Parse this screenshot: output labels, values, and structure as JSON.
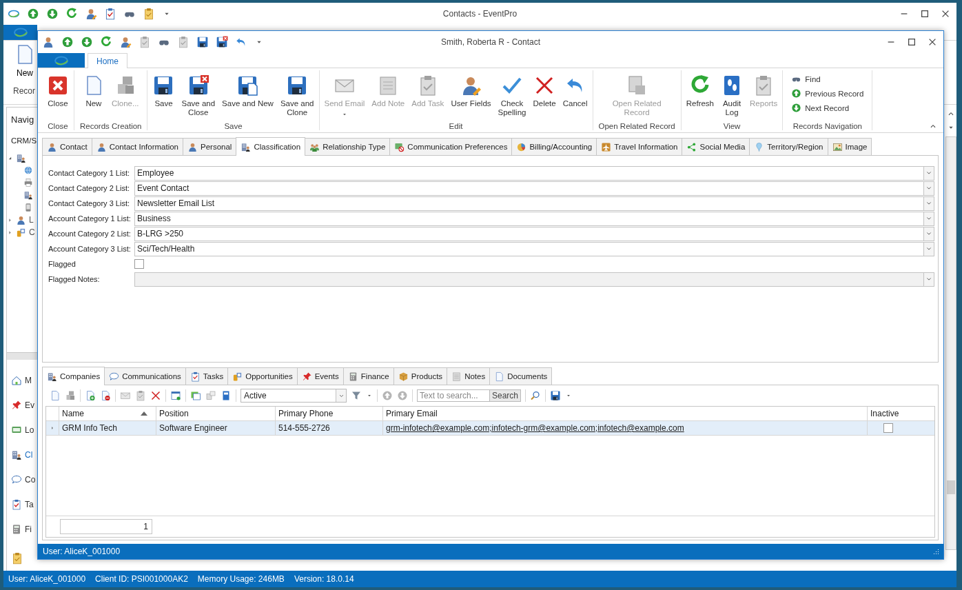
{
  "background_window": {
    "title": "Contacts - EventPro",
    "ribbon": {
      "button": "New",
      "group_label": "Recor"
    },
    "navigation": {
      "header": "Navig",
      "subheader": "CRM/S",
      "tree": [
        {
          "expanded": true,
          "children": [
            {
              "kind": "globe"
            },
            {
              "kind": "printer"
            },
            {
              "kind": "building"
            },
            {
              "kind": "phone"
            }
          ]
        },
        {
          "label": "L",
          "expanded": false
        },
        {
          "label": "C",
          "expanded": false
        }
      ],
      "items": [
        {
          "label": "M",
          "selected": false
        },
        {
          "label": "Ev",
          "selected": false
        },
        {
          "label": "Lo",
          "selected": false
        },
        {
          "label": "Cl",
          "selected": true
        },
        {
          "label": "Co",
          "selected": false
        },
        {
          "label": "Ta",
          "selected": false
        },
        {
          "label": "Fi",
          "selected": false
        }
      ]
    },
    "status_bar": [
      "User: AliceK_001000",
      "Client ID: PSI001000AK2",
      "Memory Usage: 246MB",
      "Version: 18.0.14"
    ]
  },
  "window": {
    "title": "Smith, Roberta R - Contact"
  },
  "ribbon": {
    "tabs": [
      {
        "label": "Home",
        "selected": true
      }
    ],
    "groups": [
      {
        "label": "Close",
        "buttons": [
          {
            "label": "Close",
            "disabled": false
          }
        ]
      },
      {
        "label": "Records Creation",
        "buttons": [
          {
            "label": "New",
            "disabled": false
          },
          {
            "label": "Clone...",
            "disabled": true
          }
        ]
      },
      {
        "label": "Save",
        "buttons": [
          {
            "label": "Save",
            "disabled": false
          },
          {
            "label": "Save and\nClose",
            "disabled": false
          },
          {
            "label": "Save and New",
            "disabled": false
          },
          {
            "label": "Save and\nClone",
            "disabled": false
          }
        ]
      },
      {
        "label": "Edit",
        "buttons": [
          {
            "label": "Send Email",
            "disabled": true,
            "dropdown": true
          },
          {
            "label": "Add Note",
            "disabled": true
          },
          {
            "label": "Add Task",
            "disabled": true
          },
          {
            "label": "User Fields",
            "disabled": false
          },
          {
            "label": "Check\nSpelling",
            "disabled": false
          },
          {
            "label": "Delete",
            "disabled": false
          },
          {
            "label": "Cancel",
            "disabled": false
          }
        ]
      },
      {
        "label": "Open Related Record",
        "buttons": [
          {
            "label": "Open Related\nRecord",
            "disabled": true
          }
        ]
      },
      {
        "label": "View",
        "buttons": [
          {
            "label": "Refresh",
            "disabled": false
          },
          {
            "label": "Audit\nLog",
            "disabled": false
          },
          {
            "label": "Reports",
            "disabled": true
          }
        ]
      }
    ],
    "navigation_group": {
      "label": "Records Navigation",
      "items": [
        "Find",
        "Previous Record",
        "Next Record"
      ]
    }
  },
  "tabs": [
    {
      "label": "Contact",
      "selected": false
    },
    {
      "label": "Contact Information",
      "selected": false
    },
    {
      "label": "Personal",
      "selected": false
    },
    {
      "label": "Classification",
      "selected": true
    },
    {
      "label": "Relationship Type",
      "selected": false
    },
    {
      "label": "Communication Preferences",
      "selected": false
    },
    {
      "label": "Billing/Accounting",
      "selected": false
    },
    {
      "label": "Travel Information",
      "selected": false
    },
    {
      "label": "Social Media",
      "selected": false
    },
    {
      "label": "Territory/Region",
      "selected": false
    },
    {
      "label": "Image",
      "selected": false
    }
  ],
  "fields": [
    {
      "kind": "combo",
      "label": "Contact Category 1 List:",
      "value": "Employee",
      "disabled": false
    },
    {
      "kind": "combo",
      "label": "Contact Category 2 List:",
      "value": "Event Contact",
      "disabled": false
    },
    {
      "kind": "combo",
      "label": "Contact Category 3 List:",
      "value": "Newsletter Email List",
      "disabled": false
    },
    {
      "kind": "combo",
      "label": "Account Category 1 List:",
      "value": "Business",
      "disabled": false
    },
    {
      "kind": "combo",
      "label": "Account Category 2 List:",
      "value": "B-LRG >250",
      "disabled": false
    },
    {
      "kind": "combo",
      "label": "Account Category 3 List:",
      "value": "Sci/Tech/Health",
      "disabled": false
    },
    {
      "kind": "checkbox",
      "label": "Flagged",
      "checked": false
    },
    {
      "kind": "combo",
      "label": "Flagged Notes:",
      "disabled": true
    }
  ],
  "sub_tabs": [
    {
      "label": "Companies",
      "selected": true
    },
    {
      "label": "Communications",
      "selected": false
    },
    {
      "label": "Tasks",
      "selected": false
    },
    {
      "label": "Opportunities",
      "selected": false
    },
    {
      "label": "Events",
      "selected": false
    },
    {
      "label": "Finance",
      "selected": false
    },
    {
      "label": "Products",
      "selected": false
    },
    {
      "label": "Notes",
      "selected": false
    },
    {
      "label": "Documents",
      "selected": false
    }
  ],
  "toolbar": {
    "filter": "Active",
    "search": {
      "placeholder": "Text to search..."
    },
    "search_button": "Search"
  },
  "table": {
    "columns": [
      {
        "label": "Name",
        "sorted_ascending": true
      },
      {
        "label": "Position"
      },
      {
        "label": "Primary Phone"
      },
      {
        "label": "Primary Email"
      },
      {
        "label": "Inactive"
      }
    ],
    "rows": [
      {
        "selected": true,
        "cells": [
          "GRM Info Tech",
          "Software Engineer",
          "514-555-2726",
          "grm-infotech@example.com;infotech-grm@example.com;infotech@example.com"
        ],
        "inactive": false
      }
    ],
    "footer_count": "1"
  },
  "status_bar": "User: AliceK_001000"
}
